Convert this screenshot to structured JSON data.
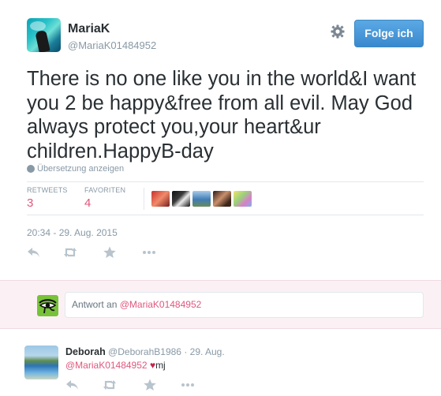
{
  "tweet": {
    "display_name": "MariaK",
    "handle": "@MariaK01484952",
    "follow_label": "Folge ich",
    "text": "There is no one like you in the world&I want you 2 be happy&free from all evil. May God always protect you,your heart&ur children.HappyB-day",
    "translate_label": "Übersetzung anzeigen",
    "retweets_label": "RETWEETS",
    "retweets_count": "3",
    "favorites_label": "FAVORITEN",
    "favorites_count": "4",
    "timestamp": "20:34 - 29. Aug. 2015"
  },
  "reply_box": {
    "prefix": "Antwort an",
    "mention": "@MariaK01484952"
  },
  "reply_tweet": {
    "display_name": "Deborah",
    "handle": "@DeborahB1986",
    "date": "· 29. Aug.",
    "mention": "@MariaK01484952",
    "heart": "♥",
    "suffix": "mj"
  },
  "colors": {
    "accent": "#e0577d",
    "follow_button": "#4a98d9",
    "muted": "#8899a6"
  }
}
